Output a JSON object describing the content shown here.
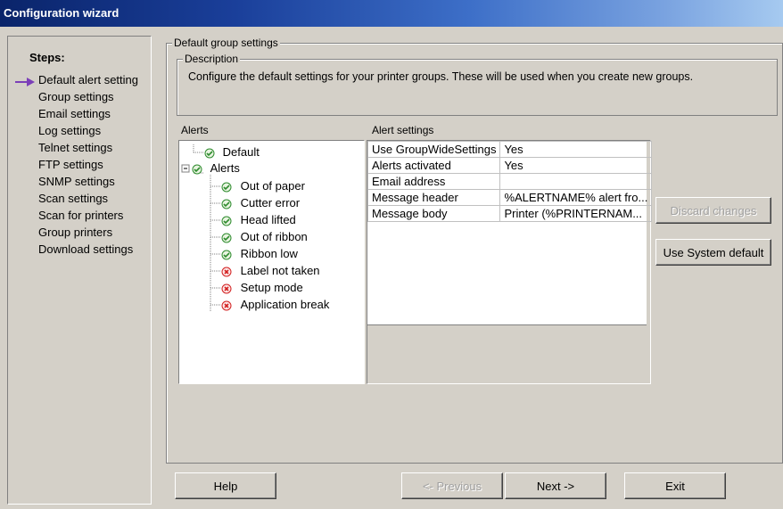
{
  "window": {
    "title": "Configuration wizard"
  },
  "sidebar": {
    "heading": "Steps:",
    "items": [
      {
        "label": "Default alert setting",
        "current": true
      },
      {
        "label": "Group settings"
      },
      {
        "label": "Email settings"
      },
      {
        "label": "Log settings"
      },
      {
        "label": "Telnet settings"
      },
      {
        "label": "FTP settings"
      },
      {
        "label": "SNMP settings"
      },
      {
        "label": "Scan settings"
      },
      {
        "label": "Scan for printers"
      },
      {
        "label": "Group printers"
      },
      {
        "label": "Download settings"
      }
    ]
  },
  "main": {
    "group_title": "Default group settings",
    "description": {
      "title": "Description",
      "text": "Configure the default settings for your printer groups. These will be used when you create new groups."
    },
    "alerts": {
      "label": "Alerts",
      "tree": [
        {
          "label": "Default",
          "status": "ok",
          "level": 0
        },
        {
          "label": "Alerts",
          "status": "ok",
          "level": 0,
          "expanded": true
        },
        {
          "label": "Out of paper",
          "status": "ok",
          "level": 1
        },
        {
          "label": "Cutter error",
          "status": "ok",
          "level": 1
        },
        {
          "label": "Head lifted",
          "status": "ok",
          "level": 1
        },
        {
          "label": "Out of ribbon",
          "status": "ok",
          "level": 1
        },
        {
          "label": "Ribbon low",
          "status": "ok",
          "level": 1
        },
        {
          "label": "Label not taken",
          "status": "error",
          "level": 1
        },
        {
          "label": "Setup mode",
          "status": "error",
          "level": 1
        },
        {
          "label": "Application break",
          "status": "error",
          "level": 1
        }
      ]
    },
    "alert_settings": {
      "label": "Alert settings",
      "rows": [
        {
          "name": "Use GroupWideSettings",
          "value": "Yes"
        },
        {
          "name": "Alerts activated",
          "value": "Yes"
        },
        {
          "name": "Email address",
          "value": ""
        },
        {
          "name": "Message header",
          "value": "%ALERTNAME% alert fro..."
        },
        {
          "name": "Message body",
          "value": "Printer (%PRINTERNAM..."
        }
      ]
    },
    "discard_label": "Discard changes",
    "system_default_label": "Use System default"
  },
  "footer": {
    "help_label": "Help",
    "previous_label": "<- Previous",
    "next_label": "Next ->",
    "exit_label": "Exit"
  },
  "colors": {
    "ok": "#2e8b2e",
    "error": "#d21f1f",
    "arrow": "#7b3fb8"
  }
}
